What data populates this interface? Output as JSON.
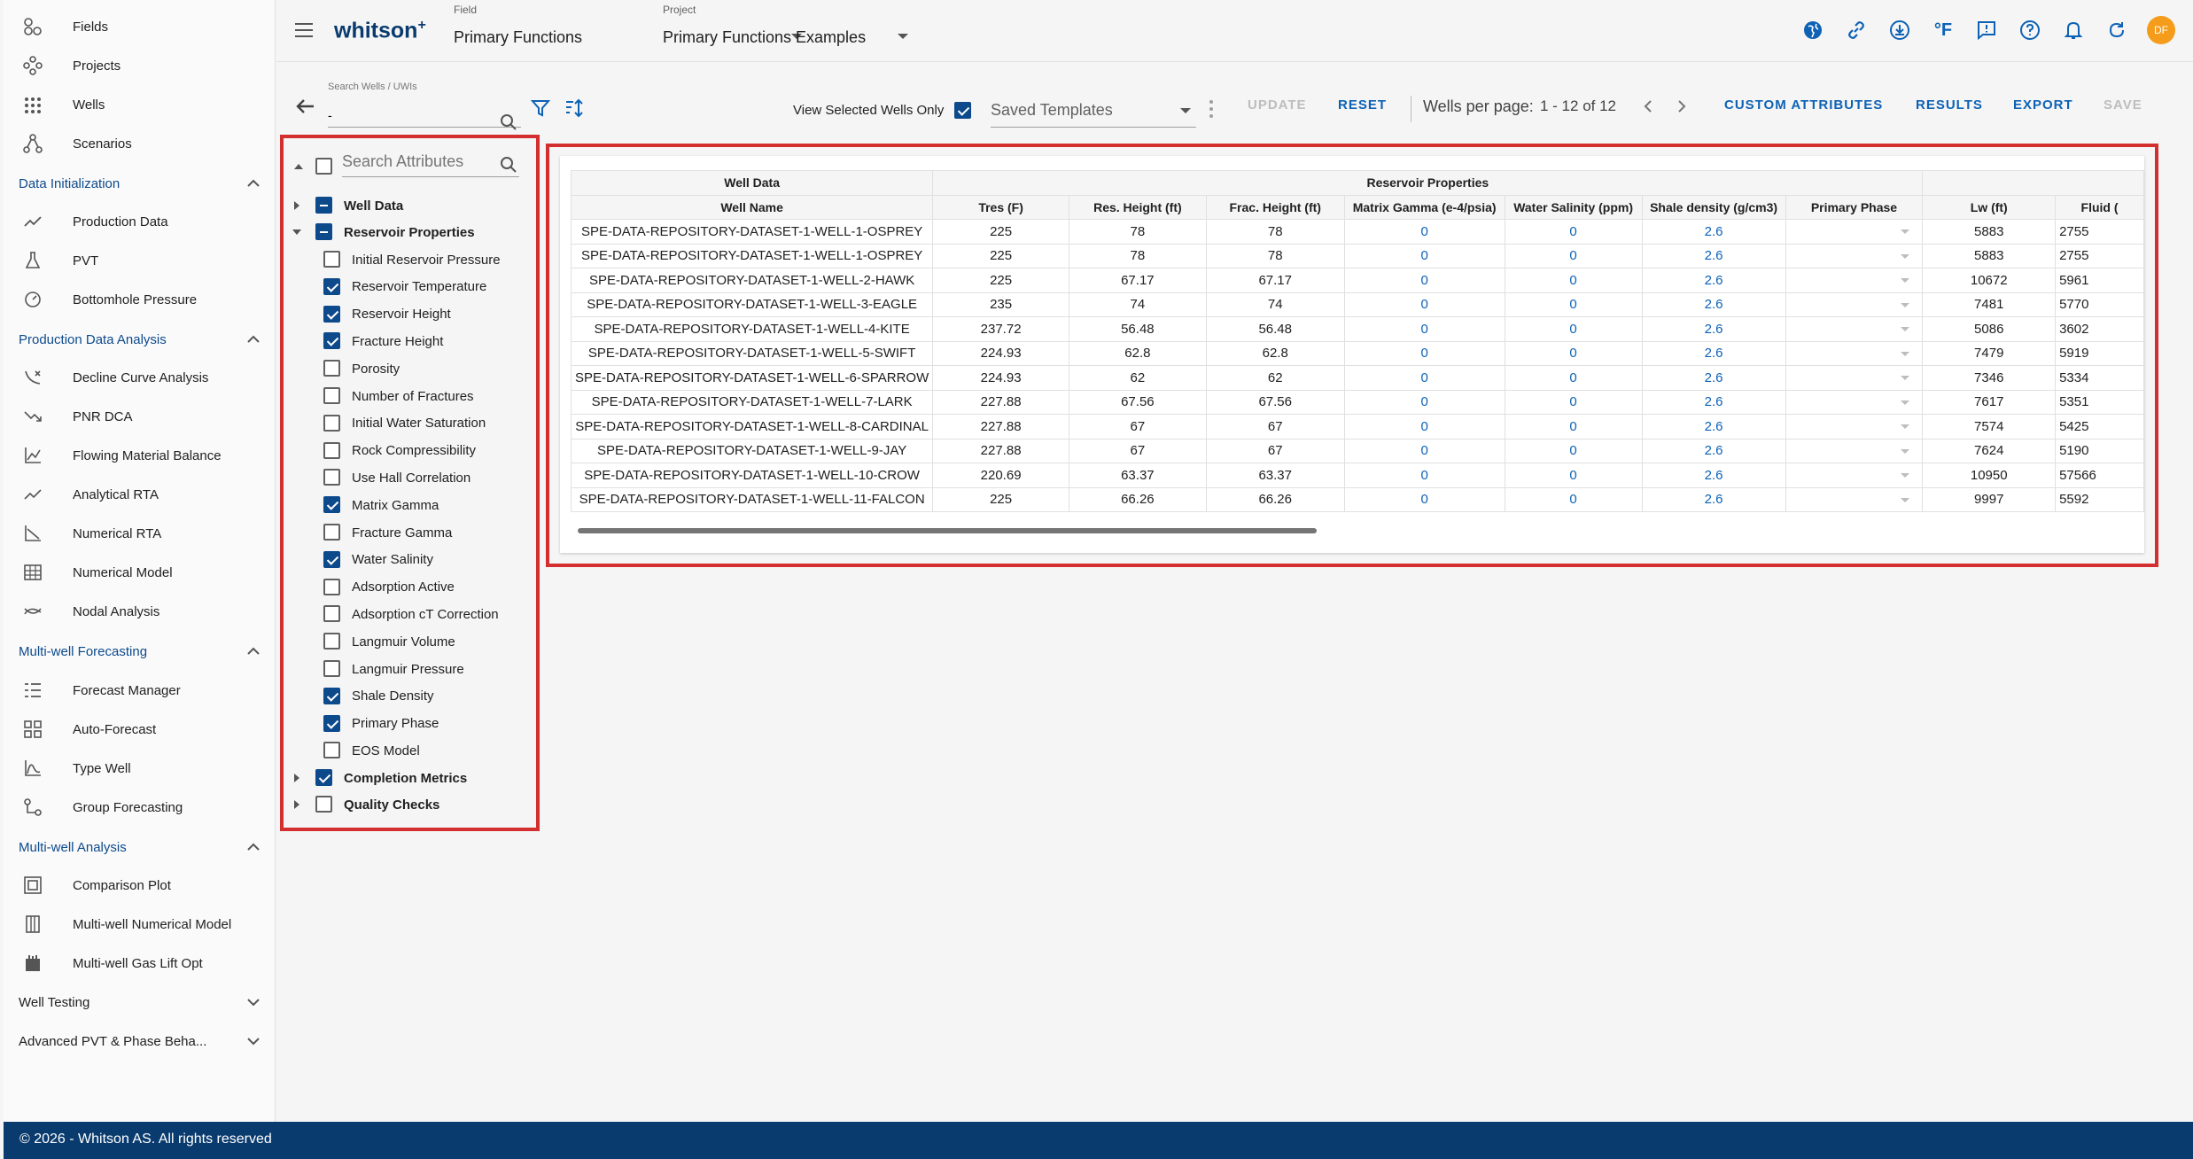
{
  "sidebar": {
    "top_items": [
      {
        "label": "Fields",
        "icon": "fields-icon"
      },
      {
        "label": "Projects",
        "icon": "projects-icon"
      },
      {
        "label": "Wells",
        "icon": "wells-icon"
      },
      {
        "label": "Scenarios",
        "icon": "scenarios-icon"
      }
    ],
    "sections": [
      {
        "title": "Data Initialization",
        "items": [
          "Production Data",
          "PVT",
          "Bottomhole Pressure"
        ]
      },
      {
        "title": "Production Data Analysis",
        "items": [
          "Decline Curve Analysis",
          "PNR DCA",
          "Flowing Material Balance",
          "Analytical RTA",
          "Numerical RTA",
          "Numerical Model",
          "Nodal Analysis"
        ]
      },
      {
        "title": "Multi-well Forecasting",
        "items": [
          "Forecast Manager",
          "Auto-Forecast",
          "Type Well",
          "Group Forecasting"
        ]
      },
      {
        "title": "Multi-well Analysis",
        "items": [
          "Comparison Plot",
          "Multi-well Numerical Model",
          "Multi-well Gas Lift Opt"
        ]
      }
    ],
    "collapsed_sections": [
      "Well Testing",
      "Advanced PVT & Phase Beha..."
    ]
  },
  "header": {
    "brand": "whitson",
    "brand_sup": "+",
    "field_label": "Field",
    "field_value": "Primary Functions",
    "project_label": "Project",
    "project_value": "Primary Functions Examples",
    "unit_icon_text": "°F",
    "avatar_initials": "DF"
  },
  "toolbar": {
    "search_label": "Search Wells / UWIs",
    "search_value": "-",
    "view_selected_label": "View Selected Wells Only",
    "templates_placeholder": "Saved Templates",
    "update_label": "UPDATE",
    "reset_label": "RESET",
    "wells_per_page_label": "Wells per page:",
    "range_label": "1 - 12 of 12",
    "custom_attributes_label": "CUSTOM ATTRIBUTES",
    "results_label": "RESULTS",
    "export_label": "EXPORT",
    "save_label": "SAVE"
  },
  "attributes": {
    "search_placeholder": "Search Attributes",
    "groups": [
      {
        "label": "Well Data",
        "state": "indeterminate",
        "expanded": false
      },
      {
        "label": "Reservoir Properties",
        "state": "indeterminate",
        "expanded": true
      }
    ],
    "reservoir_items": [
      {
        "label": "Initial Reservoir Pressure",
        "checked": false
      },
      {
        "label": "Reservoir Temperature",
        "checked": true
      },
      {
        "label": "Reservoir Height",
        "checked": true
      },
      {
        "label": "Fracture Height",
        "checked": true
      },
      {
        "label": "Porosity",
        "checked": false
      },
      {
        "label": "Number of Fractures",
        "checked": false
      },
      {
        "label": "Initial Water Saturation",
        "checked": false
      },
      {
        "label": "Rock Compressibility",
        "checked": false
      },
      {
        "label": "Use Hall Correlation",
        "checked": false
      },
      {
        "label": "Matrix Gamma",
        "checked": true
      },
      {
        "label": "Fracture Gamma",
        "checked": false
      },
      {
        "label": "Water Salinity",
        "checked": true
      },
      {
        "label": "Adsorption Active",
        "checked": false
      },
      {
        "label": "Adsorption cT Correction",
        "checked": false
      },
      {
        "label": "Langmuir Volume",
        "checked": false
      },
      {
        "label": "Langmuir Pressure",
        "checked": false
      },
      {
        "label": "Shale Density",
        "checked": true
      },
      {
        "label": "Primary Phase",
        "checked": true
      },
      {
        "label": "EOS Model",
        "checked": false
      }
    ],
    "tail_groups": [
      {
        "label": "Completion Metrics",
        "state": "checked"
      },
      {
        "label": "Quality Checks",
        "state": "unchecked"
      }
    ]
  },
  "table": {
    "group_headers": [
      {
        "label": "Well Data",
        "span": 1
      },
      {
        "label": "Reservoir Properties",
        "span": 7
      },
      {
        "label": "",
        "span": 2
      }
    ],
    "columns": [
      "Well Name",
      "Tres (F)",
      "Res. Height (ft)",
      "Frac. Height (ft)",
      "Matrix Gamma (e-4/psia)",
      "Water Salinity (ppm)",
      "Shale density (g/cm3)",
      "Primary Phase",
      "Lw (ft)",
      "Fluid ("
    ],
    "rows": [
      [
        "SPE-DATA-REPOSITORY-DATASET-1-WELL-1-OSPREY",
        "225",
        "78",
        "78",
        "0",
        "0",
        "2.6",
        "",
        "5883",
        "2755"
      ],
      [
        "SPE-DATA-REPOSITORY-DATASET-1-WELL-1-OSPREY",
        "225",
        "78",
        "78",
        "0",
        "0",
        "2.6",
        "",
        "5883",
        "2755"
      ],
      [
        "SPE-DATA-REPOSITORY-DATASET-1-WELL-2-HAWK",
        "225",
        "67.17",
        "67.17",
        "0",
        "0",
        "2.6",
        "",
        "10672",
        "5961"
      ],
      [
        "SPE-DATA-REPOSITORY-DATASET-1-WELL-3-EAGLE",
        "235",
        "74",
        "74",
        "0",
        "0",
        "2.6",
        "",
        "7481",
        "5770"
      ],
      [
        "SPE-DATA-REPOSITORY-DATASET-1-WELL-4-KITE",
        "237.72",
        "56.48",
        "56.48",
        "0",
        "0",
        "2.6",
        "",
        "5086",
        "3602"
      ],
      [
        "SPE-DATA-REPOSITORY-DATASET-1-WELL-5-SWIFT",
        "224.93",
        "62.8",
        "62.8",
        "0",
        "0",
        "2.6",
        "",
        "7479",
        "5919"
      ],
      [
        "SPE-DATA-REPOSITORY-DATASET-1-WELL-6-SPARROW",
        "224.93",
        "62",
        "62",
        "0",
        "0",
        "2.6",
        "",
        "7346",
        "5334"
      ],
      [
        "SPE-DATA-REPOSITORY-DATASET-1-WELL-7-LARK",
        "227.88",
        "67.56",
        "67.56",
        "0",
        "0",
        "2.6",
        "",
        "7617",
        "5351"
      ],
      [
        "SPE-DATA-REPOSITORY-DATASET-1-WELL-8-CARDINAL",
        "227.88",
        "67",
        "67",
        "0",
        "0",
        "2.6",
        "",
        "7574",
        "5425"
      ],
      [
        "SPE-DATA-REPOSITORY-DATASET-1-WELL-9-JAY",
        "227.88",
        "67",
        "67",
        "0",
        "0",
        "2.6",
        "",
        "7624",
        "5190"
      ],
      [
        "SPE-DATA-REPOSITORY-DATASET-1-WELL-10-CROW",
        "220.69",
        "63.37",
        "63.37",
        "0",
        "0",
        "2.6",
        "",
        "10950",
        "57566"
      ],
      [
        "SPE-DATA-REPOSITORY-DATASET-1-WELL-11-FALCON",
        "225",
        "66.26",
        "66.26",
        "0",
        "0",
        "2.6",
        "",
        "9997",
        "5592"
      ]
    ]
  },
  "footer": {
    "text": "© 2026 - Whitson AS. All rights reserved"
  },
  "colors": {
    "brand": "#0a3b6e",
    "accent": "#0d62b5",
    "highlight": "#d32f2f",
    "avatar": "#f59c1a"
  }
}
